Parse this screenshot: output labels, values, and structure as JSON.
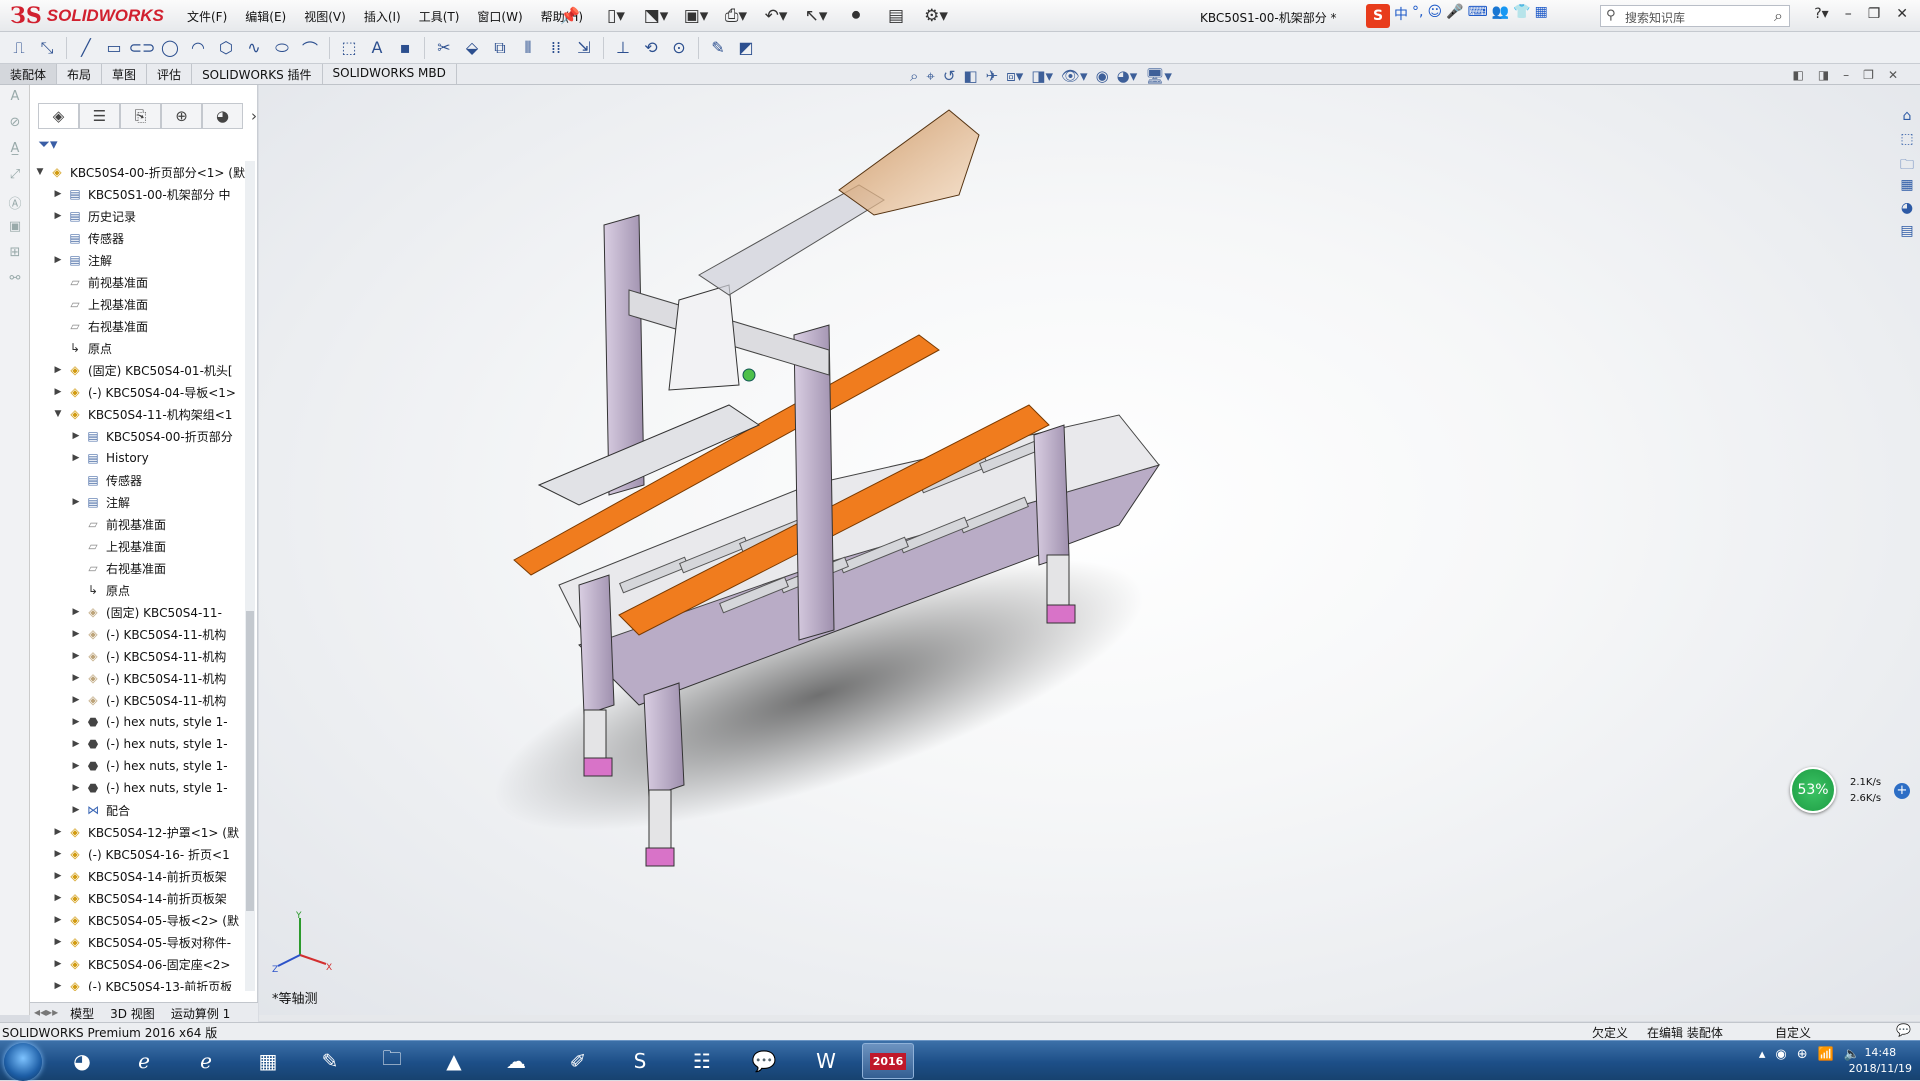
{
  "app": {
    "brand": "SOLIDWORKS",
    "window_title": "KBC50S1-00-机架部分 *",
    "menus": [
      "文件(F)",
      "编辑(E)",
      "视图(V)",
      "插入(I)",
      "工具(T)",
      "窗口(W)",
      "帮助(H)"
    ],
    "search_placeholder": "搜索知识库",
    "ime": {
      "logo": "S",
      "label": "中"
    }
  },
  "command_tabs": [
    "装配体",
    "布局",
    "草图",
    "评估",
    "SOLIDWORKS 插件",
    "SOLIDWORKS MBD"
  ],
  "feature_tree": {
    "nodes": [
      {
        "label": "KBC50S4-00-折页部分<1> (默",
        "level": 0,
        "icon": "asm",
        "exp": "open"
      },
      {
        "label": "KBC50S1-00-机架部分 中",
        "level": 1,
        "icon": "doc",
        "exp": "closed"
      },
      {
        "label": "历史记录",
        "level": 1,
        "icon": "doc",
        "exp": "closed"
      },
      {
        "label": "传感器",
        "level": 1,
        "icon": "doc",
        "exp": "none"
      },
      {
        "label": "注解",
        "level": 1,
        "icon": "doc",
        "exp": "closed"
      },
      {
        "label": "前视基准面",
        "level": 1,
        "icon": "plane",
        "exp": "none"
      },
      {
        "label": "上视基准面",
        "level": 1,
        "icon": "plane",
        "exp": "none"
      },
      {
        "label": "右视基准面",
        "level": 1,
        "icon": "plane",
        "exp": "none"
      },
      {
        "label": "原点",
        "level": 1,
        "icon": "origin",
        "exp": "none"
      },
      {
        "label": "(固定) KBC50S4-01-机头[",
        "level": 1,
        "icon": "asm",
        "exp": "closed"
      },
      {
        "label": "(-) KBC50S4-04-导板<1>",
        "level": 1,
        "icon": "asm",
        "exp": "closed"
      },
      {
        "label": "KBC50S4-11-机构架组<1",
        "level": 1,
        "icon": "asm",
        "exp": "open"
      },
      {
        "label": "KBC50S4-00-折页部分",
        "level": 2,
        "icon": "doc",
        "exp": "closed"
      },
      {
        "label": "History",
        "level": 2,
        "icon": "doc",
        "exp": "closed"
      },
      {
        "label": "传感器",
        "level": 2,
        "icon": "doc",
        "exp": "none"
      },
      {
        "label": "注解",
        "level": 2,
        "icon": "doc",
        "exp": "closed"
      },
      {
        "label": "前视基准面",
        "level": 2,
        "icon": "plane",
        "exp": "none"
      },
      {
        "label": "上视基准面",
        "level": 2,
        "icon": "plane",
        "exp": "none"
      },
      {
        "label": "右视基准面",
        "level": 2,
        "icon": "plane",
        "exp": "none"
      },
      {
        "label": "原点",
        "level": 2,
        "icon": "origin",
        "exp": "none"
      },
      {
        "label": "(固定) KBC50S4-11-",
        "level": 2,
        "icon": "part",
        "exp": "closed"
      },
      {
        "label": "(-) KBC50S4-11-机构",
        "level": 2,
        "icon": "part",
        "exp": "closed"
      },
      {
        "label": "(-) KBC50S4-11-机构",
        "level": 2,
        "icon": "part",
        "exp": "closed"
      },
      {
        "label": "(-) KBC50S4-11-机构",
        "level": 2,
        "icon": "part",
        "exp": "closed"
      },
      {
        "label": "(-) KBC50S4-11-机构",
        "level": 2,
        "icon": "part",
        "exp": "closed"
      },
      {
        "label": "(-) hex nuts, style 1-",
        "level": 2,
        "icon": "nut",
        "exp": "closed"
      },
      {
        "label": "(-) hex nuts, style 1-",
        "level": 2,
        "icon": "nut",
        "exp": "closed"
      },
      {
        "label": "(-) hex nuts, style 1-",
        "level": 2,
        "icon": "nut",
        "exp": "closed"
      },
      {
        "label": "(-) hex nuts, style 1-",
        "level": 2,
        "icon": "nut",
        "exp": "closed"
      },
      {
        "label": "配合",
        "level": 2,
        "icon": "mate",
        "exp": "closed"
      },
      {
        "label": "KBC50S4-12-护罩<1> (默",
        "level": 1,
        "icon": "asm",
        "exp": "closed"
      },
      {
        "label": "(-) KBC50S4-16- 折页<1",
        "level": 1,
        "icon": "asm",
        "exp": "closed"
      },
      {
        "label": "KBC50S4-14-前折页板架",
        "level": 1,
        "icon": "asm",
        "exp": "closed"
      },
      {
        "label": "KBC50S4-14-前折页板架",
        "level": 1,
        "icon": "asm",
        "exp": "closed"
      },
      {
        "label": "KBC50S4-05-导板<2> (默",
        "level": 1,
        "icon": "asm",
        "exp": "closed"
      },
      {
        "label": "KBC50S4-05-导板对称件-",
        "level": 1,
        "icon": "asm",
        "exp": "closed"
      },
      {
        "label": "KBC50S4-06-固定座<2>",
        "level": 1,
        "icon": "asm",
        "exp": "closed"
      },
      {
        "label": "(-) KBC50S4-13-前折页板",
        "level": 1,
        "icon": "asm",
        "exp": "closed"
      }
    ]
  },
  "bottom_tabs": [
    "模型",
    "3D 视图",
    "运动算例 1"
  ],
  "view": {
    "name": "*等轴测",
    "triad_x": "X",
    "triad_y": "Y",
    "triad_z": "Z"
  },
  "network": {
    "percent": "53%",
    "up": "2.1K/s",
    "down": "2.6K/s"
  },
  "status": {
    "left": "SOLIDWORKS Premium 2016 x64 版",
    "defined": "欠定义",
    "editing": "在编辑 装配体",
    "units": "自定义"
  },
  "taskbar": {
    "time": "14:48",
    "date": "2018/11/19",
    "sw_badge": "2016"
  },
  "colors": {
    "accent_orange": "#f07c1e",
    "frame_purple": "#c3b6cf",
    "brand_red": "#d1202f"
  }
}
